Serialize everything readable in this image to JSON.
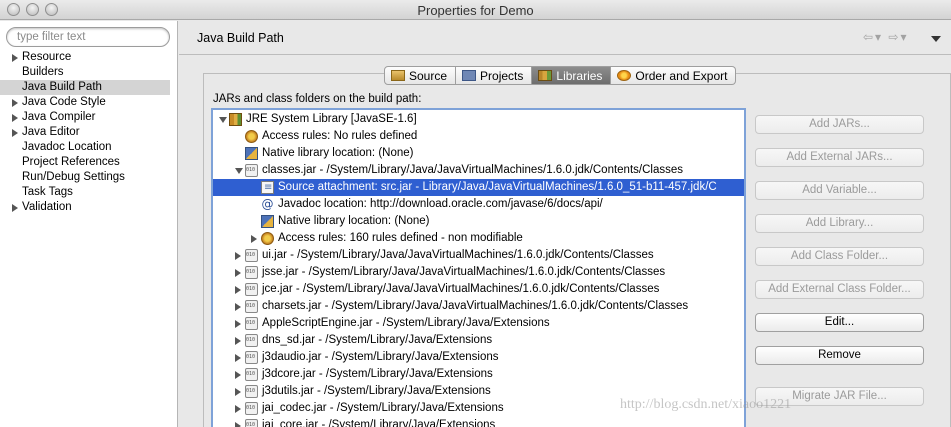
{
  "window": {
    "title": "Properties for Demo"
  },
  "sidebar": {
    "filter_placeholder": "type filter text",
    "items": [
      {
        "label": "Resource",
        "expandable": true
      },
      {
        "label": "Builders",
        "expandable": false
      },
      {
        "label": "Java Build Path",
        "expandable": false,
        "selected": true
      },
      {
        "label": "Java Code Style",
        "expandable": true
      },
      {
        "label": "Java Compiler",
        "expandable": true
      },
      {
        "label": "Java Editor",
        "expandable": true
      },
      {
        "label": "Javadoc Location",
        "expandable": false
      },
      {
        "label": "Project References",
        "expandable": false
      },
      {
        "label": "Run/Debug Settings",
        "expandable": false
      },
      {
        "label": "Task Tags",
        "expandable": false
      },
      {
        "label": "Validation",
        "expandable": true
      }
    ]
  },
  "page": {
    "title": "Java Build Path",
    "tabs": [
      {
        "label": "Source",
        "icon": "source-folder-icon"
      },
      {
        "label": "Projects",
        "icon": "projects-icon"
      },
      {
        "label": "Libraries",
        "icon": "libraries-icon",
        "active": true
      },
      {
        "label": "Order and Export",
        "icon": "order-export-icon"
      }
    ],
    "section_label": "JARs and class folders on the build path:"
  },
  "tree": [
    {
      "label": "JRE System Library [JavaSE-1.6]",
      "icon": "jre-library-icon",
      "depth": 0,
      "toggle": "open"
    },
    {
      "label": "Access rules: No rules defined",
      "icon": "access-rules-icon",
      "depth": 1,
      "toggle": "none"
    },
    {
      "label": "Native library location: (None)",
      "icon": "native-library-icon",
      "depth": 1,
      "toggle": "none"
    },
    {
      "label": "classes.jar - /System/Library/Java/JavaVirtualMachines/1.6.0.jdk/Contents/Classes",
      "icon": "jar-icon",
      "depth": 1,
      "toggle": "open"
    },
    {
      "label": "Source attachment: src.jar - Library/Java/JavaVirtualMachines/1.6.0_51-b11-457.jdk/C",
      "icon": "source-attachment-icon",
      "depth": 2,
      "toggle": "none",
      "selected": true
    },
    {
      "label": "Javadoc location: http://download.oracle.com/javase/6/docs/api/",
      "icon": "javadoc-icon",
      "depth": 2,
      "toggle": "none"
    },
    {
      "label": "Native library location: (None)",
      "icon": "native-library-icon",
      "depth": 2,
      "toggle": "none"
    },
    {
      "label": "Access rules: 160 rules defined - non modifiable",
      "icon": "access-rules-icon",
      "depth": 2,
      "toggle": "closed"
    },
    {
      "label": "ui.jar - /System/Library/Java/JavaVirtualMachines/1.6.0.jdk/Contents/Classes",
      "icon": "jar-icon",
      "depth": 1,
      "toggle": "closed"
    },
    {
      "label": "jsse.jar - /System/Library/Java/JavaVirtualMachines/1.6.0.jdk/Contents/Classes",
      "icon": "jar-icon",
      "depth": 1,
      "toggle": "closed"
    },
    {
      "label": "jce.jar - /System/Library/Java/JavaVirtualMachines/1.6.0.jdk/Contents/Classes",
      "icon": "jar-icon",
      "depth": 1,
      "toggle": "closed"
    },
    {
      "label": "charsets.jar - /System/Library/Java/JavaVirtualMachines/1.6.0.jdk/Contents/Classes",
      "icon": "jar-icon",
      "depth": 1,
      "toggle": "closed"
    },
    {
      "label": "AppleScriptEngine.jar - /System/Library/Java/Extensions",
      "icon": "jar-icon",
      "depth": 1,
      "toggle": "closed"
    },
    {
      "label": "dns_sd.jar - /System/Library/Java/Extensions",
      "icon": "jar-icon",
      "depth": 1,
      "toggle": "closed"
    },
    {
      "label": "j3daudio.jar - /System/Library/Java/Extensions",
      "icon": "jar-icon",
      "depth": 1,
      "toggle": "closed"
    },
    {
      "label": "j3dcore.jar - /System/Library/Java/Extensions",
      "icon": "jar-icon",
      "depth": 1,
      "toggle": "closed"
    },
    {
      "label": "j3dutils.jar - /System/Library/Java/Extensions",
      "icon": "jar-icon",
      "depth": 1,
      "toggle": "closed"
    },
    {
      "label": "jai_codec.jar - /System/Library/Java/Extensions",
      "icon": "jar-icon",
      "depth": 1,
      "toggle": "closed"
    },
    {
      "label": "jai_core.jar - /System/Library/Java/Extensions",
      "icon": "jar-icon",
      "depth": 1,
      "toggle": "closed"
    }
  ],
  "buttons": [
    {
      "label": "Add JARs...",
      "enabled": false
    },
    {
      "label": "Add External JARs...",
      "enabled": false
    },
    {
      "label": "Add Variable...",
      "enabled": false
    },
    {
      "label": "Add Library...",
      "enabled": false
    },
    {
      "label": "Add Class Folder...",
      "enabled": false
    },
    {
      "label": "Add External Class Folder...",
      "enabled": false
    },
    {
      "label": "Edit...",
      "enabled": true
    },
    {
      "label": "Remove",
      "enabled": true
    },
    {
      "label": "Migrate JAR File...",
      "enabled": false
    }
  ],
  "watermark": "http://blog.csdn.net/xiaoo1221",
  "colors": {
    "selection": "#2f5fd1",
    "tree_border": "#7ea2d8",
    "sidebar_selection": "#d4d4d4"
  }
}
